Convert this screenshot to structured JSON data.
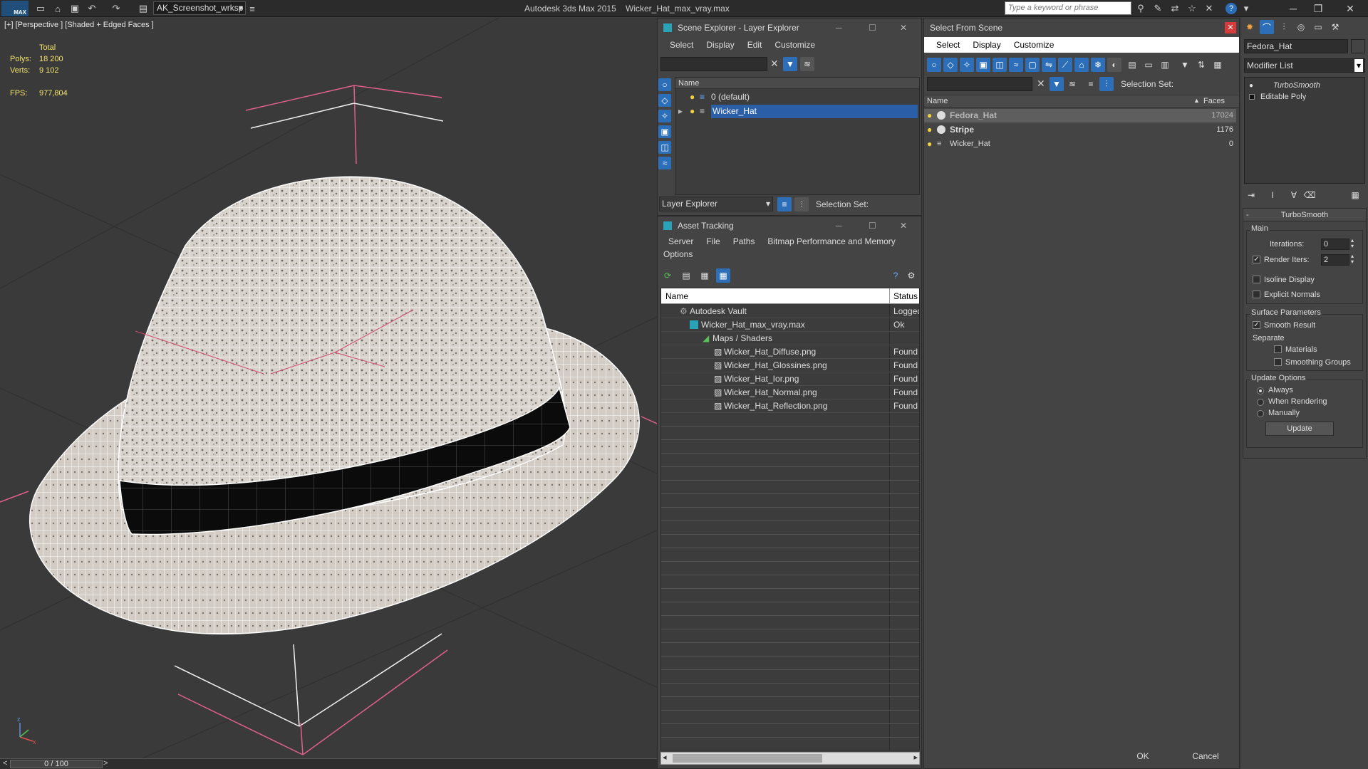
{
  "app": {
    "title": "Autodesk 3ds Max  2015",
    "file": "Wicker_Hat_max_vray.max",
    "workspace": "AK_Screenshot_wrksp",
    "search_placeholder": "Type a keyword or phrase",
    "logo_text": "MAX"
  },
  "viewport": {
    "label": "[+] [Perspective ] [Shaded + Edged Faces ]",
    "stats": {
      "total_label": "Total",
      "polys_label": "Polys:",
      "polys_value": "18 200",
      "verts_label": "Verts:",
      "verts_value": "9 102",
      "fps_label": "FPS:",
      "fps_value": "977,804"
    },
    "timeline": "0 / 100",
    "prev": "<",
    "next": ">",
    "axis_z": "z",
    "axis_x": "x"
  },
  "scene_explorer": {
    "title": "Scene Explorer - Layer Explorer",
    "menu": [
      "Select",
      "Display",
      "Edit",
      "Customize"
    ],
    "column_name": "Name",
    "layers": [
      {
        "name": "0 (default)",
        "selected": false
      },
      {
        "name": "Wicker_Hat",
        "selected": true
      }
    ],
    "footer_dropdown": "Layer Explorer",
    "selection_set_label": "Selection Set:"
  },
  "asset_tracking": {
    "title": "Asset Tracking",
    "menu": [
      "Server",
      "File",
      "Paths",
      "Bitmap Performance and Memory"
    ],
    "menu2": "Options",
    "col_name": "Name",
    "col_status": "Status",
    "rows": [
      {
        "name": "Autodesk Vault",
        "status": "Logged",
        "indent": 0
      },
      {
        "name": "Wicker_Hat_max_vray.max",
        "status": "Ok",
        "indent": 1
      },
      {
        "name": "Maps / Shaders",
        "status": "",
        "indent": 2
      },
      {
        "name": "Wicker_Hat_Diffuse.png",
        "status": "Found",
        "indent": 3
      },
      {
        "name": "Wicker_Hat_Glossines.png",
        "status": "Found",
        "indent": 3
      },
      {
        "name": "Wicker_Hat_Ior.png",
        "status": "Found",
        "indent": 3
      },
      {
        "name": "Wicker_Hat_Normal.png",
        "status": "Found",
        "indent": 3
      },
      {
        "name": "Wicker_Hat_Reflection.png",
        "status": "Found",
        "indent": 3
      }
    ]
  },
  "select_from_scene": {
    "title": "Select From Scene",
    "menu": [
      "Select",
      "Display",
      "Customize"
    ],
    "selection_set_label": "Selection Set:",
    "col_name": "Name",
    "col_faces": "Faces",
    "objects": [
      {
        "name": "Fedora_Hat",
        "faces": "17024",
        "bold": true,
        "selected": true
      },
      {
        "name": "Stripe",
        "faces": "1176",
        "bold": true,
        "selected": false
      },
      {
        "name": "Wicker_Hat",
        "faces": "0",
        "bold": false,
        "selected": false
      }
    ],
    "ok": "OK",
    "cancel": "Cancel"
  },
  "modify_panel": {
    "object_name": "Fedora_Hat",
    "modifier_list": "Modifier List",
    "stack": [
      "TurboSmooth",
      "Editable Poly"
    ],
    "rollout_title": "TurboSmooth",
    "main_label": "Main",
    "iterations_label": "Iterations:",
    "iterations_value": "0",
    "render_iters_label": "Render Iters:",
    "render_iters_value": "2",
    "isoline": "Isoline Display",
    "explicit_normals": "Explicit Normals",
    "surface_params": "Surface Parameters",
    "smooth_result": "Smooth Result",
    "separate": "Separate",
    "materials": "Materials",
    "smoothing_groups": "Smoothing Groups",
    "update_options": "Update Options",
    "always": "Always",
    "when_rendering": "When Rendering",
    "manually": "Manually",
    "update_btn": "Update",
    "collapse": "-"
  },
  "colors": {
    "selection_blue": "#2a5fa8",
    "stat_yellow": "#f2e36b",
    "gizmo_pink": "#e0608a"
  }
}
